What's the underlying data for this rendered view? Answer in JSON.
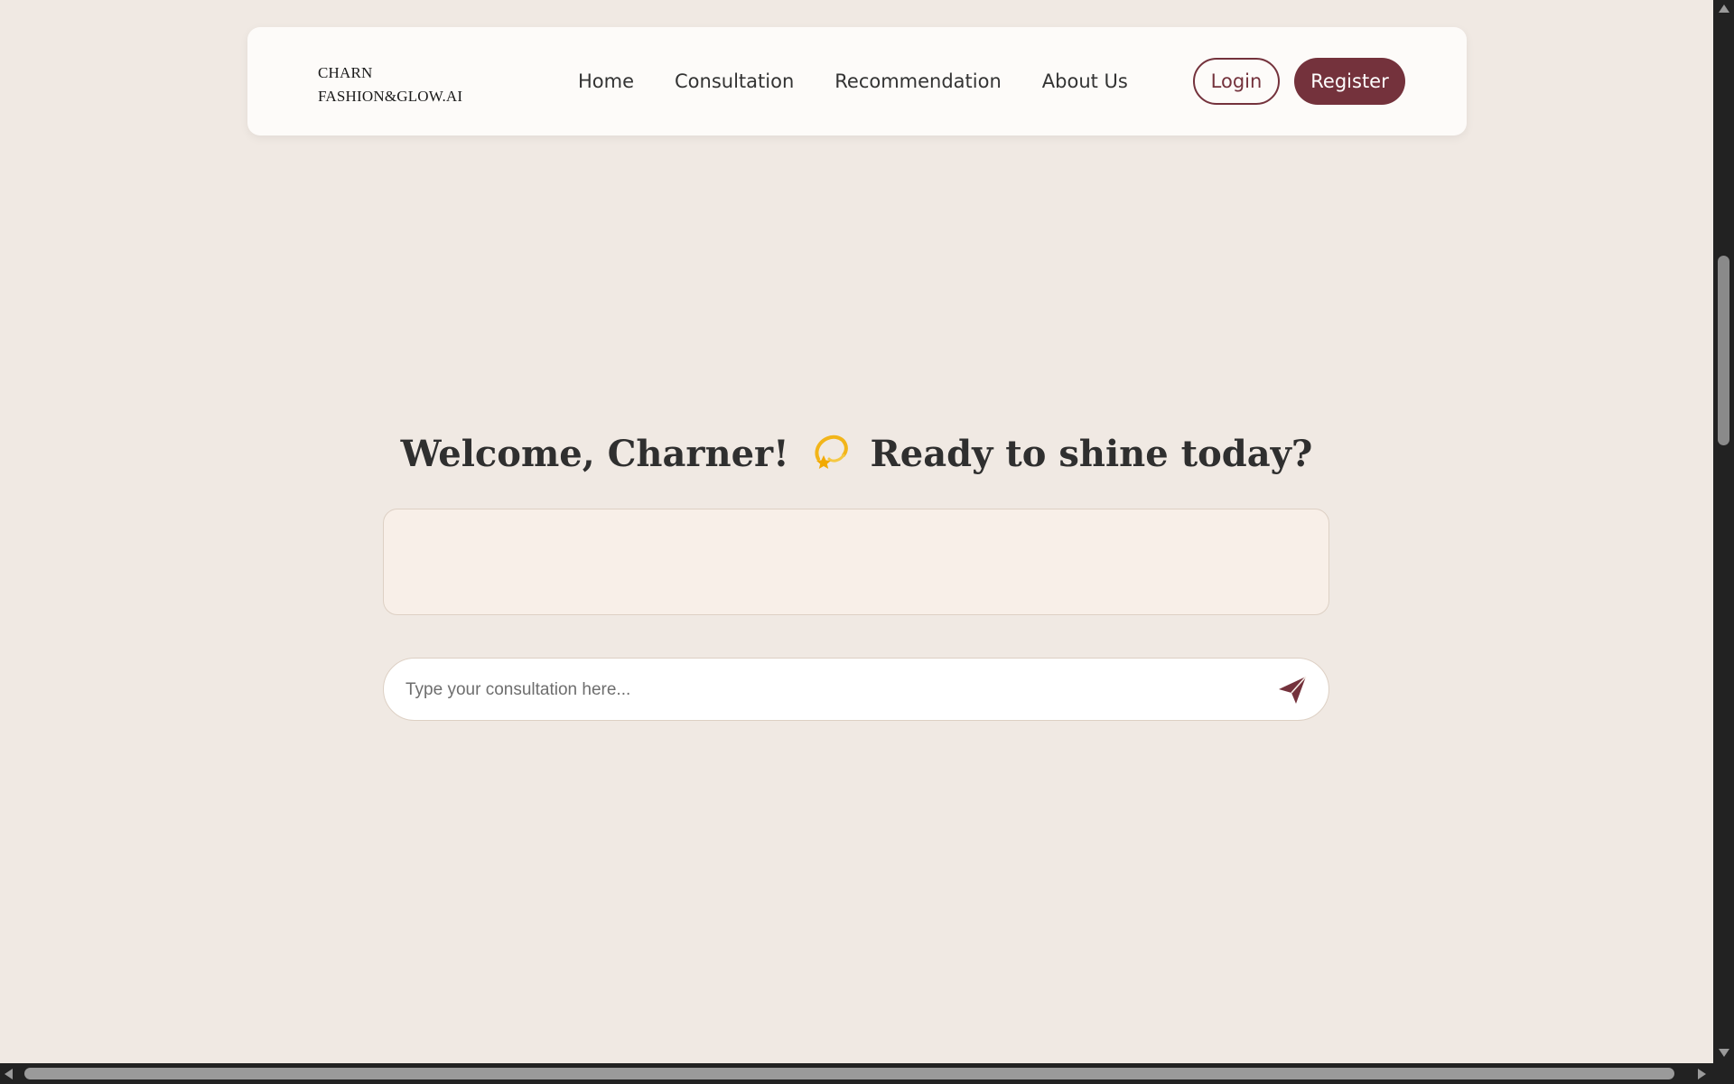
{
  "brand": {
    "line1": "CHARN",
    "line2": "FASHION&GLOW.AI"
  },
  "nav": {
    "items": [
      {
        "label": "Home"
      },
      {
        "label": "Consultation"
      },
      {
        "label": "Recommendation"
      },
      {
        "label": "About Us"
      }
    ],
    "login_label": "Login",
    "register_label": "Register"
  },
  "welcome": {
    "part1": "Welcome, Charner!",
    "emoji_icon": "dizzy-star-icon",
    "part2": "Ready to shine today?"
  },
  "response": {
    "text": ""
  },
  "chat": {
    "placeholder": "Type your consultation here...",
    "value": "",
    "send_icon": "paper-plane-icon"
  },
  "colors": {
    "background": "#f0e9e3",
    "navbar": "#fdfbf9",
    "accent": "#74323c",
    "response_box": "#f8efe8",
    "heading": "#2f2f2f"
  }
}
